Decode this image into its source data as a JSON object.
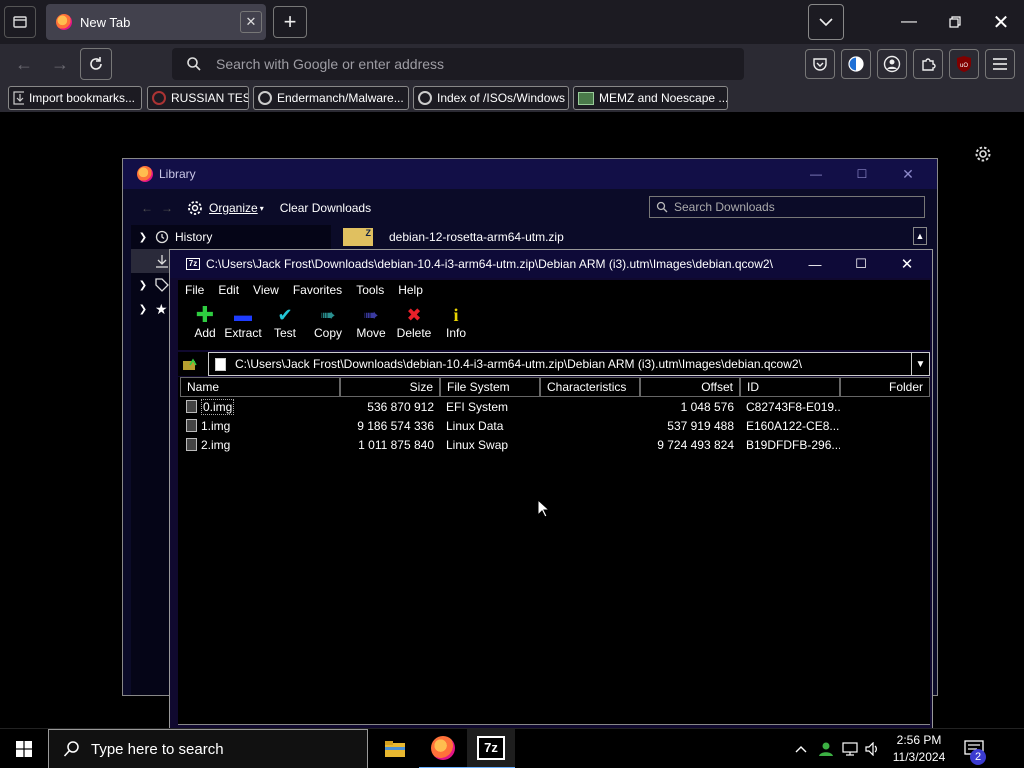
{
  "browser": {
    "tab_title": "New Tab",
    "address_placeholder": "Search with Google or enter address",
    "bookmarks": [
      {
        "label": "Import bookmarks..."
      },
      {
        "label": "RUSSIAN TEST"
      },
      {
        "label": "Endermanch/Malware..."
      },
      {
        "label": "Index of /ISOs/Windows"
      },
      {
        "label": "MEMZ and Noescape ..."
      }
    ]
  },
  "library": {
    "title": "Library",
    "organize_label": "Organize",
    "clear_label": "Clear Downloads",
    "search_placeholder": "Search Downloads",
    "sidebar": [
      {
        "label": "History"
      }
    ],
    "download_item": "debian-12-rosetta-arm64-utm.zip"
  },
  "sevenzip": {
    "title": "C:\\Users\\Jack Frost\\Downloads\\debian-10.4-i3-arm64-utm.zip\\Debian ARM (i3).utm\\Images\\debian.qcow2\\",
    "logo": "7z",
    "menu": [
      "File",
      "Edit",
      "View",
      "Favorites",
      "Tools",
      "Help"
    ],
    "toolbar": [
      {
        "label": "Add",
        "glyph": "✚",
        "color": "#2ecc40"
      },
      {
        "label": "Extract",
        "glyph": "▬",
        "color": "#1e3cff"
      },
      {
        "label": "Test",
        "glyph": "✔",
        "color": "#22c6d6"
      },
      {
        "label": "Copy",
        "glyph": "➠",
        "color": "#2a8f8f"
      },
      {
        "label": "Move",
        "glyph": "➠",
        "color": "#3a3aa0"
      },
      {
        "label": "Delete",
        "glyph": "✖",
        "color": "#e8202a"
      },
      {
        "label": "Info",
        "glyph": "i",
        "color": "#e8d400"
      }
    ],
    "address": "C:\\Users\\Jack Frost\\Downloads\\debian-10.4-i3-arm64-utm.zip\\Debian ARM (i3).utm\\Images\\debian.qcow2\\",
    "columns": [
      "Name",
      "Size",
      "File System",
      "Characteristics",
      "Offset",
      "ID",
      "Folder"
    ],
    "rows": [
      {
        "name": "0.img",
        "size": "536 870 912",
        "fs": "EFI System",
        "chars": "",
        "offset": "1 048 576",
        "id": "C82743F8-E019..."
      },
      {
        "name": "1.img",
        "size": "9 186 574 336",
        "fs": "Linux Data",
        "chars": "",
        "offset": "537 919 488",
        "id": "E160A122-CE8..."
      },
      {
        "name": "2.img",
        "size": "1 011 875 840",
        "fs": "Linux Swap",
        "chars": "",
        "offset": "9 724 493 824",
        "id": "B19DFDFB-296..."
      }
    ]
  },
  "taskbar": {
    "search_placeholder": "Type here to search",
    "time": "2:56 PM",
    "date": "11/3/2024",
    "notification_count": "2",
    "sevenzip_icon": "7z"
  }
}
